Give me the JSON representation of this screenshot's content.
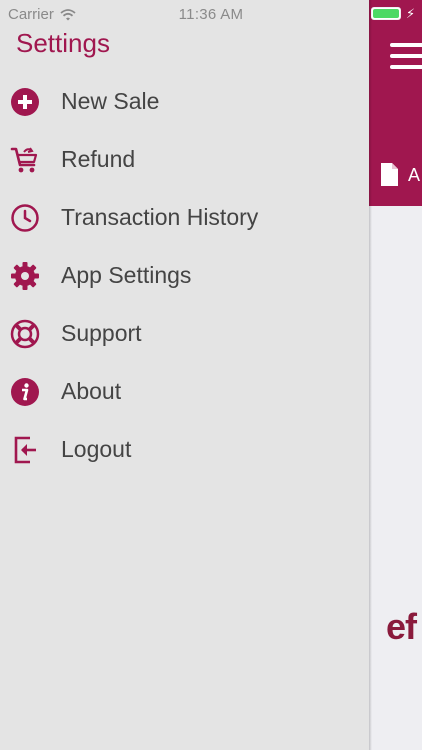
{
  "status_bar": {
    "carrier": "Carrier",
    "time": "11:36 AM",
    "battery_level": 1.0
  },
  "drawer": {
    "title": "Settings",
    "items": [
      {
        "label": "New Sale",
        "icon": "plus-circle-icon"
      },
      {
        "label": "Refund",
        "icon": "cart-return-icon"
      },
      {
        "label": "Transaction History",
        "icon": "clock-icon"
      },
      {
        "label": "App Settings",
        "icon": "gear-icon"
      },
      {
        "label": "Support",
        "icon": "lifebuoy-icon"
      },
      {
        "label": "About",
        "icon": "info-icon"
      },
      {
        "label": "Logout",
        "icon": "logout-icon"
      }
    ]
  },
  "main": {
    "header_text": "A",
    "logo_text": "ef"
  },
  "colors": {
    "accent": "#a0174f",
    "drawer_background": "#e4e4e4",
    "menu_text": "#444444"
  }
}
